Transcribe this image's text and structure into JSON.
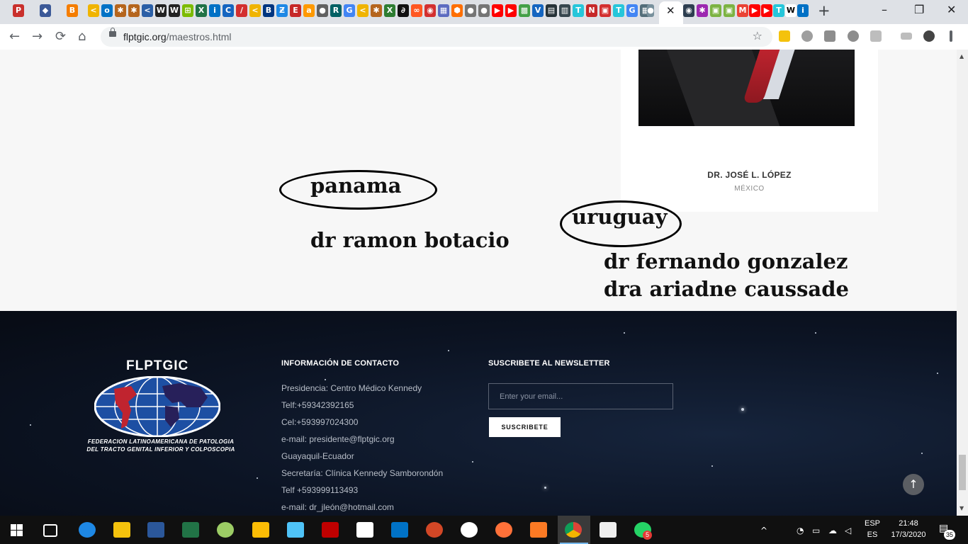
{
  "browser": {
    "url_host": "flptgic.org",
    "url_path": "/maestros.html",
    "window_controls": [
      "–",
      "❐",
      "✕"
    ],
    "tab_close": "✕",
    "new_tab": "+",
    "nav": {
      "back": "←",
      "forward": "→",
      "reload": "⟳",
      "home": "⌂"
    },
    "star": "☆"
  },
  "card": {
    "name": "DR. JOSÉ L. LÓPEZ",
    "country": "MÉXICO"
  },
  "annotations": {
    "panama": "panama",
    "panama_doctor": "dr ramon botacio",
    "uruguay": "uruguay",
    "uruguay_doctor_1": "dr fernando gonzalez",
    "uruguay_doctor_2": "dra ariadne caussade"
  },
  "footer": {
    "logo_title": "FLPTGIC",
    "federation_line1": "FEDERACION LATINOAMERICANA DE PATOLOGIA",
    "federation_line2": "DEL TRACTO GENITAL INFERIOR Y COLPOSCOPIA",
    "contact_title": "INFORMACIÓN DE CONTACTO",
    "contact_lines": [
      "Presidencia: Centro Médico Kennedy",
      "Telf:+59342392165",
      "Cel:+593997024300",
      "e-mail: presidente@flptgic.org",
      "Guayaquil-Ecuador",
      "Secretaría: Clínica Kennedy Samborondón",
      "Telf +593999113493",
      "e-mail: dr_jleón@hotmail.com"
    ],
    "newsletter_title": "SUSCRIBETE AL NEWSLETTER",
    "email_placeholder": "Enter your email...",
    "subscribe_label": "SUSCRIBETE",
    "back_to_top": "↑"
  },
  "taskbar": {
    "lang_top": "ESP",
    "lang_bottom": "ES",
    "time": "21:48",
    "date": "17/3/2020",
    "notifications": "35",
    "whatsapp_badge": "5"
  },
  "colors": {
    "footer_bg": "#0c1424",
    "accent_red": "#c0242f",
    "taskbar": "#101010"
  }
}
